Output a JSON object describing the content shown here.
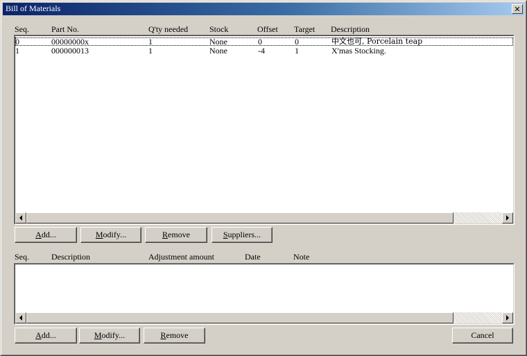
{
  "window": {
    "title": "Bill of Materials"
  },
  "top_table": {
    "columns": [
      "Seq.",
      "Part No.",
      "Q'ty needed",
      "Stock",
      "Offset",
      "Target",
      "Description"
    ],
    "rows": [
      [
        "0",
        "00000000x",
        "1",
        "None",
        "0",
        "0",
        "中文也可, Porcelain teap"
      ],
      [
        "1",
        "000000013",
        "1",
        "None",
        "-4",
        "1",
        "X'mas Stocking."
      ]
    ]
  },
  "top_buttons": {
    "add": "Add...",
    "modify": "Modify...",
    "remove": "Remove",
    "suppliers": "Suppliers..."
  },
  "bottom_table": {
    "columns": [
      "Seq.",
      "Description",
      "Adjustment amount",
      "Date",
      "Note"
    ],
    "rows": []
  },
  "bottom_buttons": {
    "add": "Add...",
    "modify": "Modify...",
    "remove": "Remove",
    "cancel": "Cancel"
  },
  "icons": {
    "close": "close-icon",
    "scroll_left": "arrow-left-icon",
    "scroll_right": "arrow-right-icon"
  }
}
